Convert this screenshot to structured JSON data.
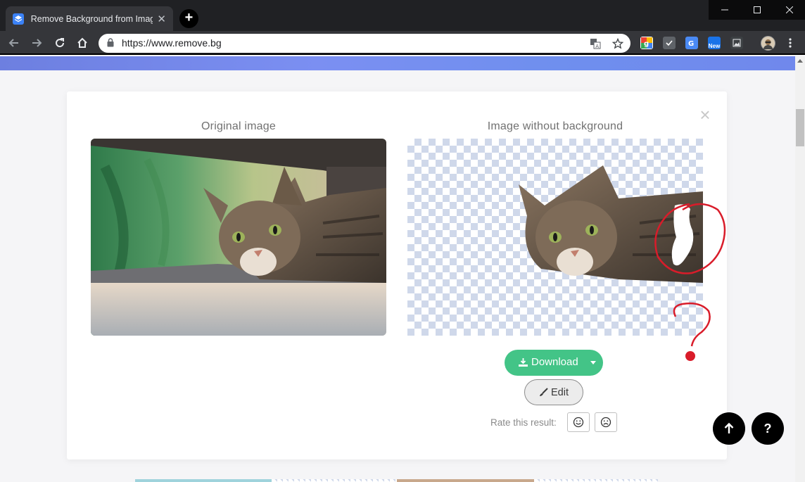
{
  "browser": {
    "tab_title": "Remove Background from Image",
    "tab_close": "✕",
    "new_tab": "+",
    "url": "https://www.remove.bg",
    "window_controls": {
      "minimize": "—",
      "maximize": "☐",
      "close": "✕"
    },
    "extensions": [
      {
        "name": "google-ext-icon",
        "color": "#4285f4",
        "label": ""
      },
      {
        "name": "checkbox-ext-icon",
        "color": "#5f6368",
        "label": ""
      },
      {
        "name": "translate-ext-icon",
        "color": "#4a8af4",
        "label": ""
      },
      {
        "name": "new-ext-icon",
        "color": "#1a73e8",
        "label": "New"
      },
      {
        "name": "image-ext-icon",
        "color": "#3c4043",
        "label": ""
      }
    ]
  },
  "modal": {
    "close_label": "×",
    "original_title": "Original image",
    "result_title": "Image without background",
    "download_label": "Download",
    "edit_label": "Edit",
    "rate_label": "Rate this result:"
  },
  "floating": {
    "scroll_top": "↑",
    "help": "?"
  },
  "colors": {
    "accent_green": "#43c487",
    "banner": "#7084ea",
    "annotation_red": "#d91c2a",
    "checker": "#cfd8ea"
  }
}
